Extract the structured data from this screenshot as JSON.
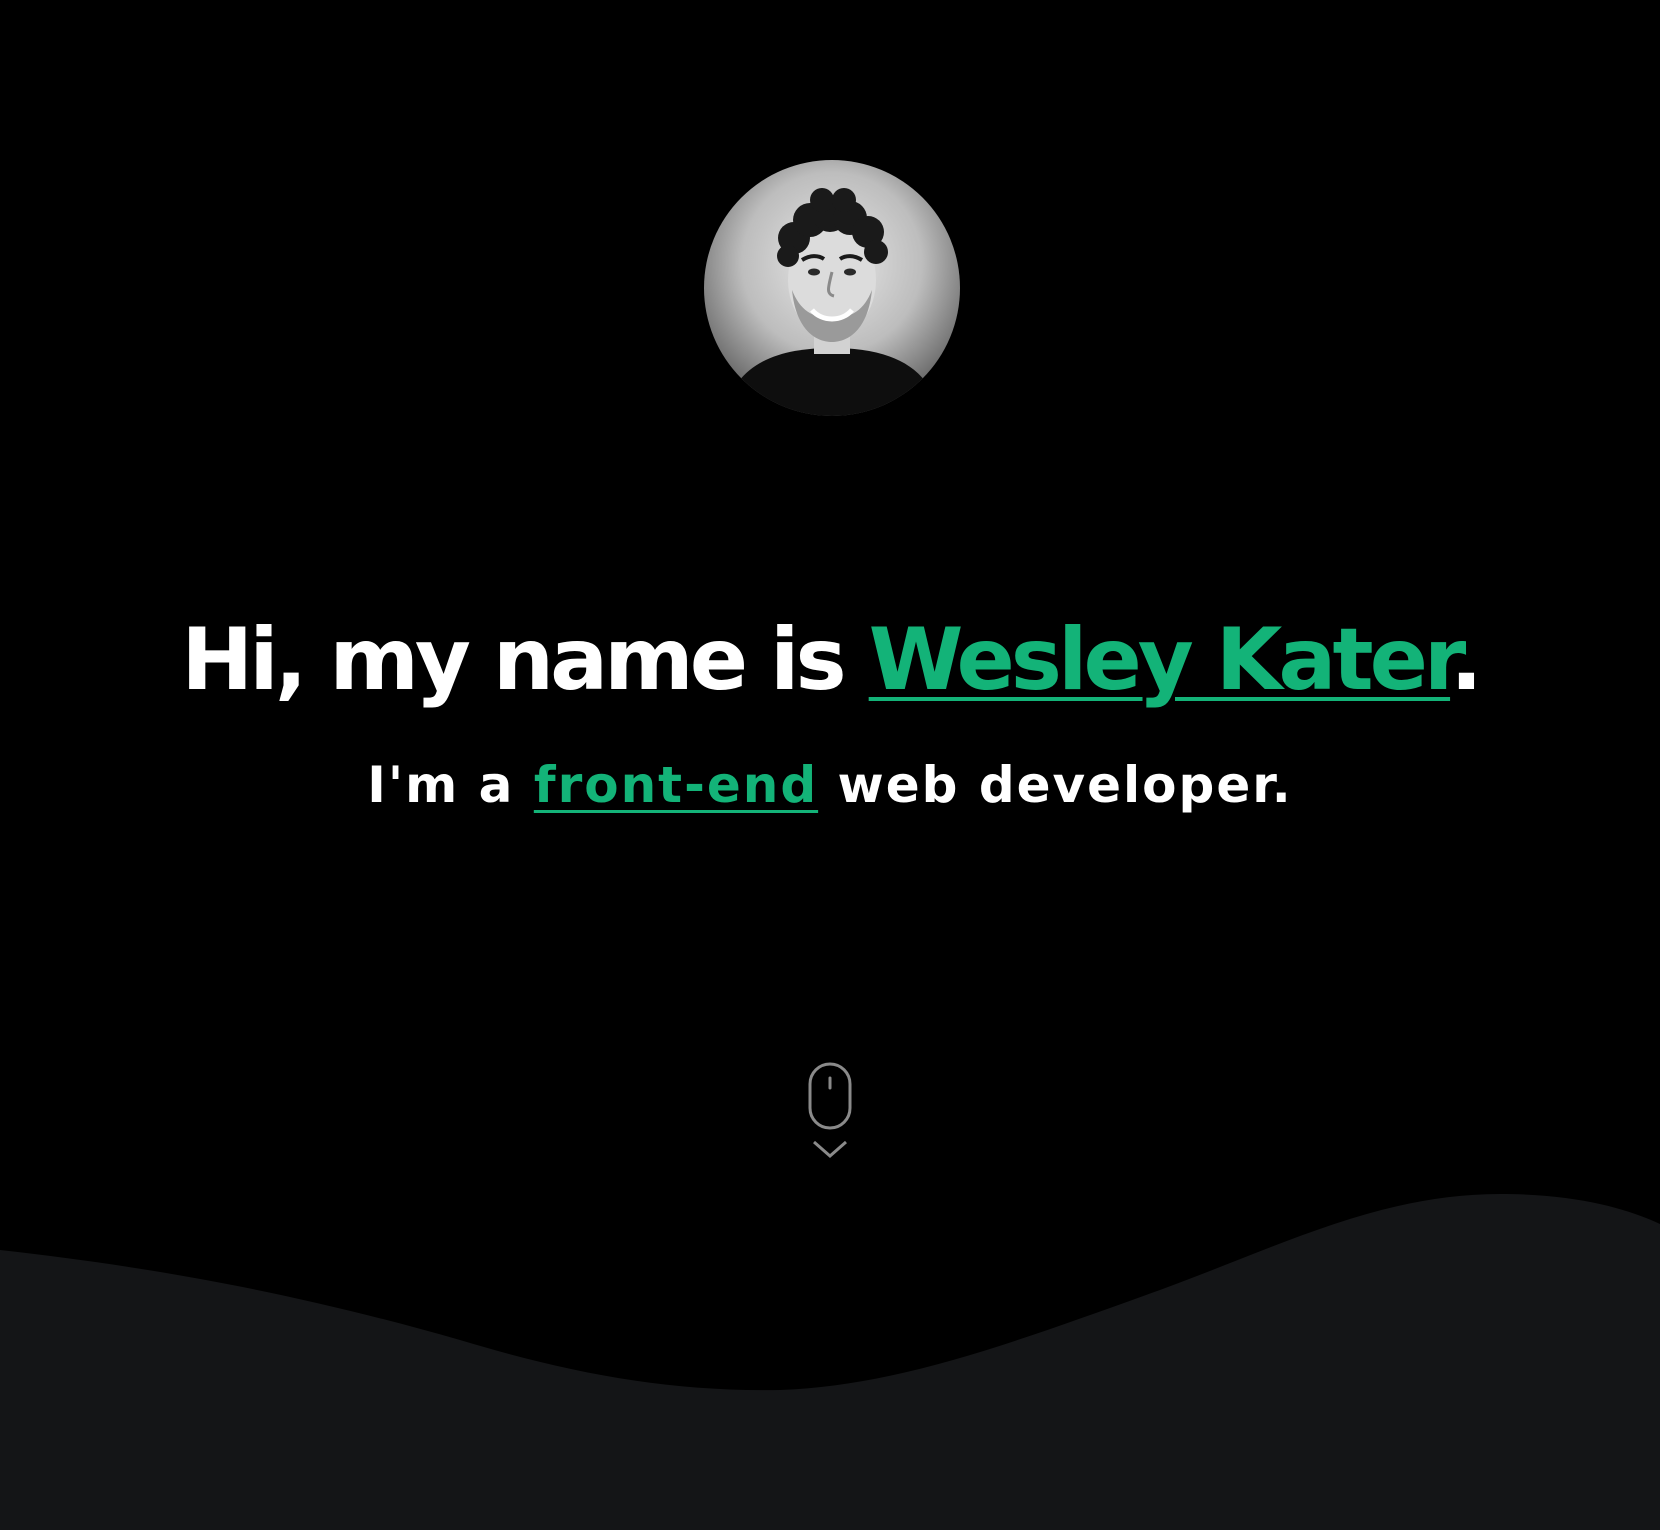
{
  "hero": {
    "avatar_alt": "Portrait photo",
    "headline": {
      "prefix": "Hi, my name is ",
      "name": "Wesley Kater",
      "suffix": "."
    },
    "subline": {
      "prefix": "I'm a ",
      "role": "front-end",
      "suffix": " web developer."
    },
    "scroll_icon": "mouse-scroll-icon"
  },
  "colors": {
    "background": "#000000",
    "accent": "#13b378",
    "text": "#ffffff",
    "wave": "#141517",
    "icon": "#8a8a8a"
  }
}
